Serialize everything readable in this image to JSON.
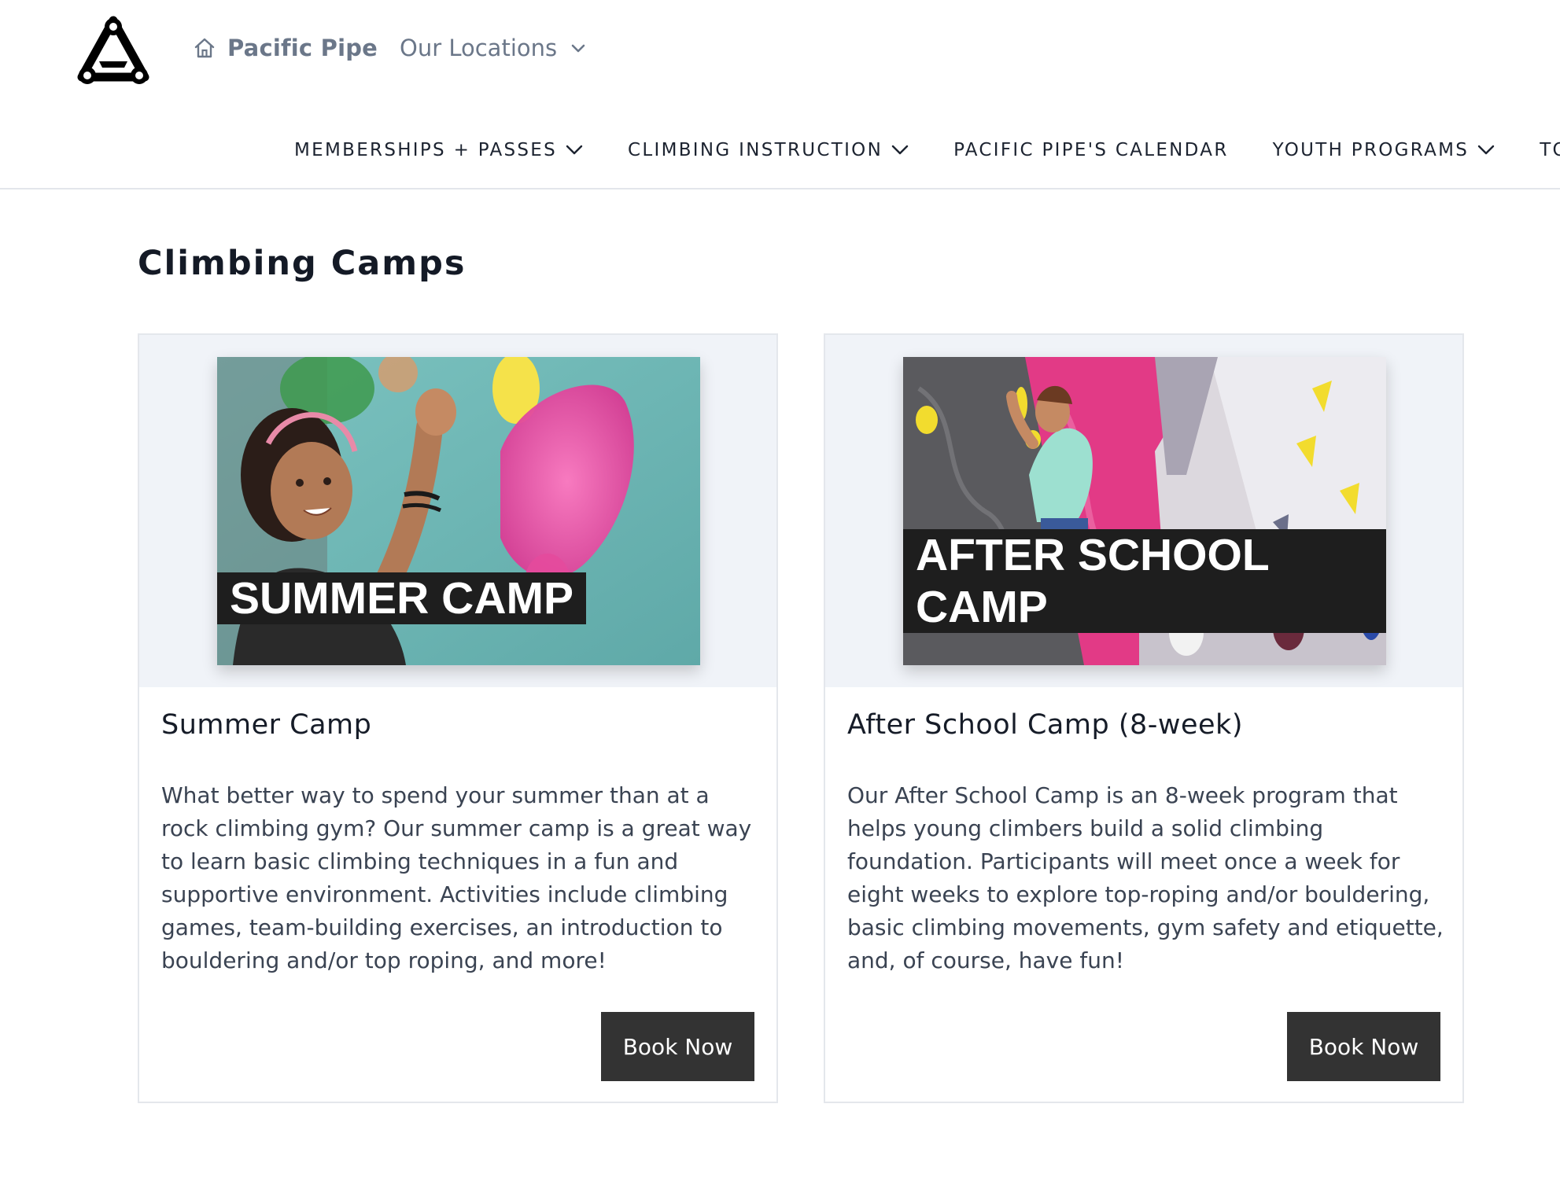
{
  "header": {
    "brand": "Pacific Pipe",
    "locations_label": "Our Locations"
  },
  "nav": {
    "items": [
      {
        "label": "MEMBERSHIPS + PASSES",
        "has_dropdown": true
      },
      {
        "label": "CLIMBING INSTRUCTION",
        "has_dropdown": true
      },
      {
        "label": "PACIFIC PIPE'S CALENDAR",
        "has_dropdown": false
      },
      {
        "label": "YOUTH PROGRAMS",
        "has_dropdown": true
      },
      {
        "label": "TOUCH",
        "has_dropdown": false
      }
    ]
  },
  "page": {
    "title": "Climbing Camps"
  },
  "cards": [
    {
      "image_caption": "SUMMER CAMP",
      "title": "Summer Camp",
      "description": "What better way to spend your summer than at a rock climbing gym? Our summer camp is a great way to learn basic climbing techniques in a fun and supportive environment. Activities include climbing games, team-building exercises, an introduction to bouldering and/or top roping, and more!",
      "button_label": "Book Now"
    },
    {
      "image_caption": "AFTER SCHOOL CAMP",
      "title": "After School Camp (8-week)",
      "description": "Our After School Camp is an 8-week program that helps young climbers build a solid climbing foundation. Participants will meet once a week for eight weeks to explore top-roping and/or bouldering, basic climbing movements, gym safety and etiquette, and, of course, have fun!",
      "button_label": "Book Now"
    }
  ],
  "colors": {
    "button_bg": "#333333",
    "media_bg": "#f0f3f8",
    "muted_text": "#6b7789"
  },
  "icons": [
    "logo-icon",
    "home-icon",
    "chevron-down-icon"
  ]
}
